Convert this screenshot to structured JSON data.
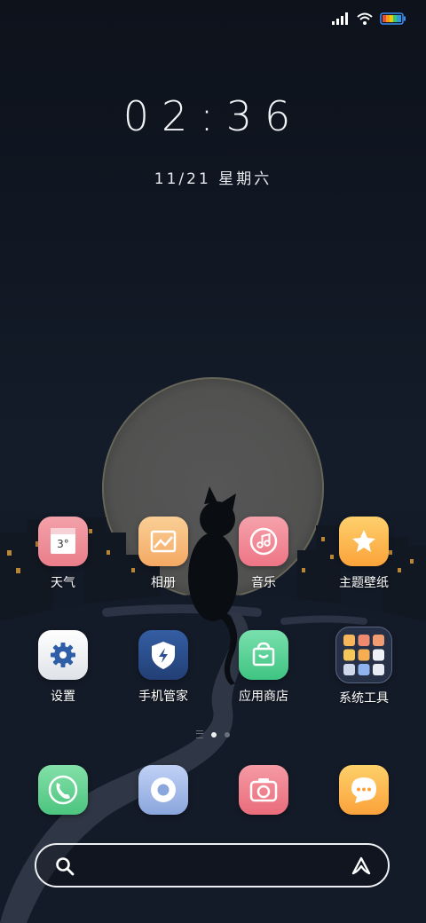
{
  "status_bar": {
    "icons": [
      "signal-icon",
      "wifi-icon",
      "battery-icon"
    ]
  },
  "lock": {
    "time": "02:36",
    "date": "11/21  星期六"
  },
  "apps": [
    {
      "label": "天气",
      "icon": "weather-icon",
      "badge": "3°",
      "color": "#ef8a94"
    },
    {
      "label": "相册",
      "icon": "gallery-icon",
      "color": "#f7b774"
    },
    {
      "label": "音乐",
      "icon": "music-icon",
      "color": "#f17d8c"
    },
    {
      "label": "主题壁纸",
      "icon": "theme-icon",
      "color": "#fcb94a"
    },
    {
      "label": "设置",
      "icon": "settings-icon",
      "color": "#f3f4f6"
    },
    {
      "label": "手机管家",
      "icon": "phone-manager-icon",
      "color": "#2c4f8f"
    },
    {
      "label": "应用商店",
      "icon": "app-store-icon",
      "color": "#54cf95"
    },
    {
      "label": "系统工具",
      "icon": "system-tools-folder-icon",
      "color": "#1f2b40"
    }
  ],
  "dock": [
    {
      "icon": "phone-icon",
      "color": "#5fd08d"
    },
    {
      "icon": "browser-icon",
      "color": "#9fb8e8"
    },
    {
      "icon": "camera-icon",
      "color": "#ef7985"
    },
    {
      "icon": "messages-icon",
      "color": "#fcb848"
    }
  ],
  "pager": {
    "pages": 2,
    "current": 1
  },
  "search": {
    "icons": [
      "search-icon",
      "assistant-icon"
    ]
  }
}
